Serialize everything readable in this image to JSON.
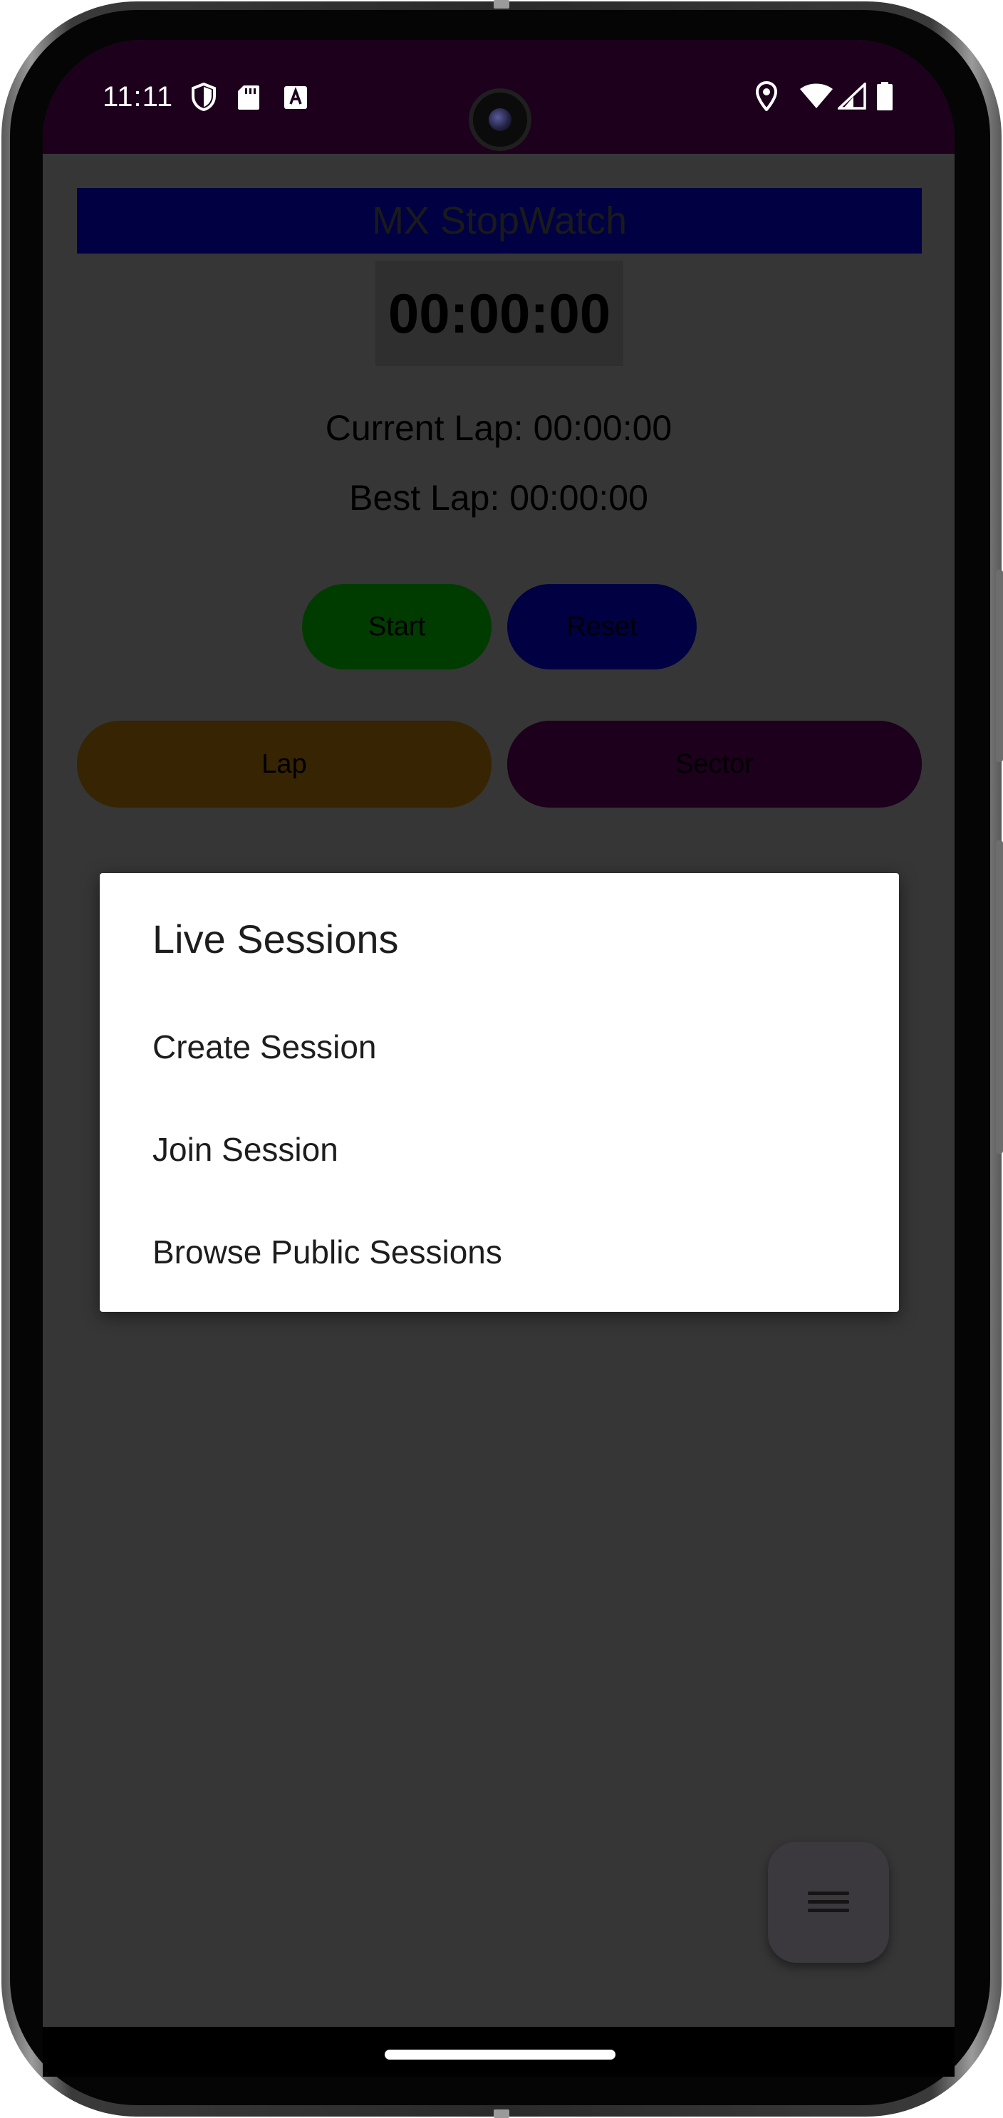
{
  "status_bar": {
    "time": "11:11",
    "left_icons": [
      "shield-icon",
      "sd-card-icon",
      "keyboard-a-icon"
    ],
    "right_icons": [
      "location-icon",
      "wifi-icon",
      "signal-icon",
      "battery-icon"
    ]
  },
  "app": {
    "title": "MX StopWatch",
    "timer": "00:00:00",
    "current_lap": "Current Lap: 00:00:00",
    "best_lap": "Best Lap: 00:00:00",
    "buttons": {
      "start": "Start",
      "reset": "Reset",
      "lap": "Lap",
      "sector": "Sector"
    },
    "colors": {
      "start": "#003b00",
      "reset": "#000043",
      "lap": "#372402",
      "sector": "#1c001c",
      "title_bar": "#000043",
      "status_bar": "#1c001c",
      "scrim_background": "#363636"
    }
  },
  "dialog": {
    "title": "Live Sessions",
    "items": [
      "Create Session",
      "Join Session",
      "Browse Public Sessions"
    ]
  },
  "fab": {
    "icon": "menu-icon"
  }
}
